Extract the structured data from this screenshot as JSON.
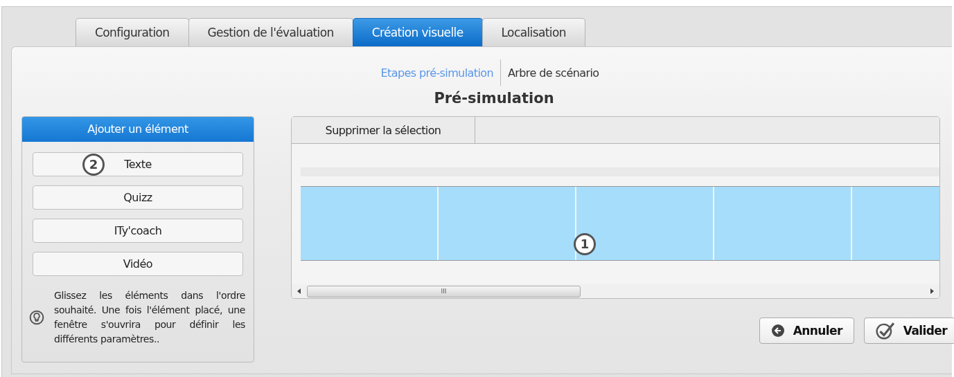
{
  "tabs": [
    {
      "label": "Configuration",
      "selected": false
    },
    {
      "label": "Gestion de l'évaluation",
      "selected": false
    },
    {
      "label": "Création visuelle",
      "selected": true
    },
    {
      "label": "Localisation",
      "selected": false
    }
  ],
  "subnav": [
    {
      "label": "Etapes pré-simulation",
      "selected": true
    },
    {
      "label": "Arbre de scénario",
      "selected": false
    }
  ],
  "title": "Pré-simulation",
  "add_panel": {
    "header": "Ajouter un élément",
    "callout": "2",
    "buttons": [
      "Texte",
      "Quizz",
      "ITy'coach",
      "Vidéo"
    ],
    "hint": "Glissez les éléments dans l'ordre souhaité. Une fois l'élément placé, une fenêtre s'ouvrira pour définir les différents paramètres.."
  },
  "timeline": {
    "toolbar": [
      "Supprimer la sélection"
    ],
    "callout": "1",
    "scrollbar_grip": "III"
  },
  "actions": [
    {
      "label": "Annuler",
      "kind": "back"
    },
    {
      "label": "Valider",
      "kind": "check"
    }
  ]
}
